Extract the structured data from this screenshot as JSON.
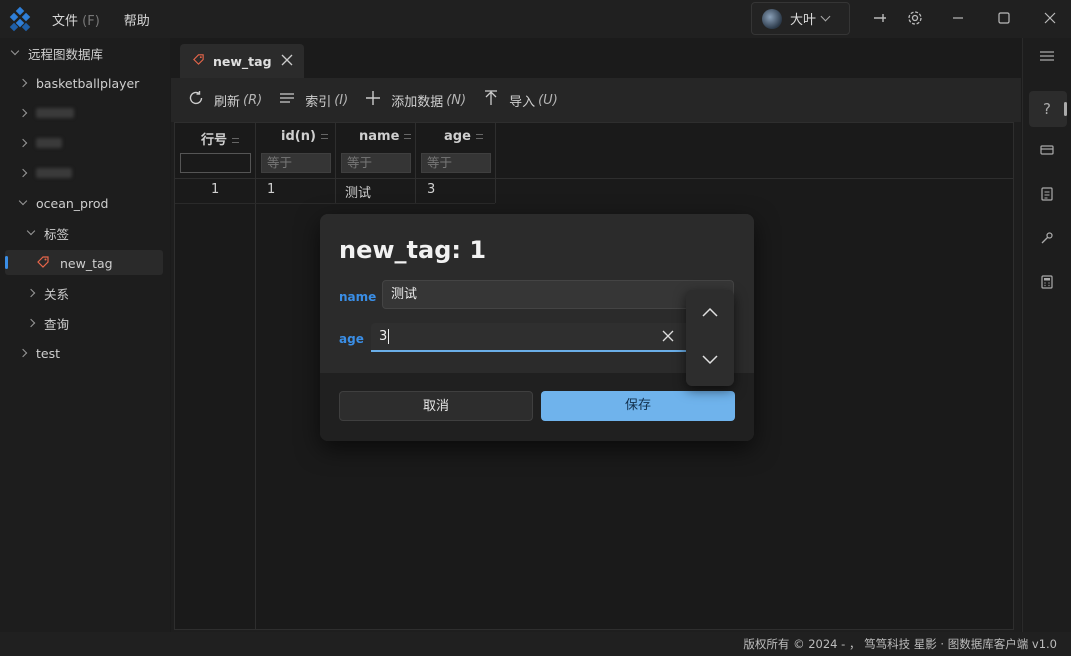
{
  "titlebar": {
    "menu": [
      {
        "label": "文件",
        "hint": "(F)"
      },
      {
        "label": "帮助",
        "hint": ""
      }
    ],
    "user": {
      "name": "大叶"
    }
  },
  "sidebar": {
    "root": "远程图数据库",
    "items": [
      {
        "label": "basketballplayer"
      },
      {
        "label": "ocean_prod"
      },
      {
        "label": "标签"
      },
      {
        "label": "new_tag"
      },
      {
        "label": "关系"
      },
      {
        "label": "查询"
      },
      {
        "label": "test"
      }
    ]
  },
  "tab": {
    "label": "new_tag"
  },
  "toolbar": {
    "refresh": {
      "label": "刷新",
      "hint": "(R)"
    },
    "index": {
      "label": "索引",
      "hint": "(I)"
    },
    "add": {
      "label": "添加数据",
      "hint": "(N)"
    },
    "import": {
      "label": "导入",
      "hint": "(U)"
    }
  },
  "grid": {
    "columns": [
      "行号",
      "id(n)",
      "name",
      "age"
    ],
    "filter_placeholder": "等于",
    "rows": [
      {
        "row_no": "1",
        "id": "1",
        "name": "测试",
        "age": "3"
      }
    ]
  },
  "dialog": {
    "title": "new_tag: 1",
    "fields": [
      {
        "label": "name",
        "value": "测试"
      },
      {
        "label": "age",
        "value": "3"
      }
    ],
    "cancel": "取消",
    "save": "保存"
  },
  "statusbar": {
    "text": "版权所有 © 2024 - ， 笃笃科技   星影 · 图数据库客户端  v1.0"
  },
  "colors": {
    "accent": "#3a8ee6",
    "save_button": "#6fb3ec"
  }
}
